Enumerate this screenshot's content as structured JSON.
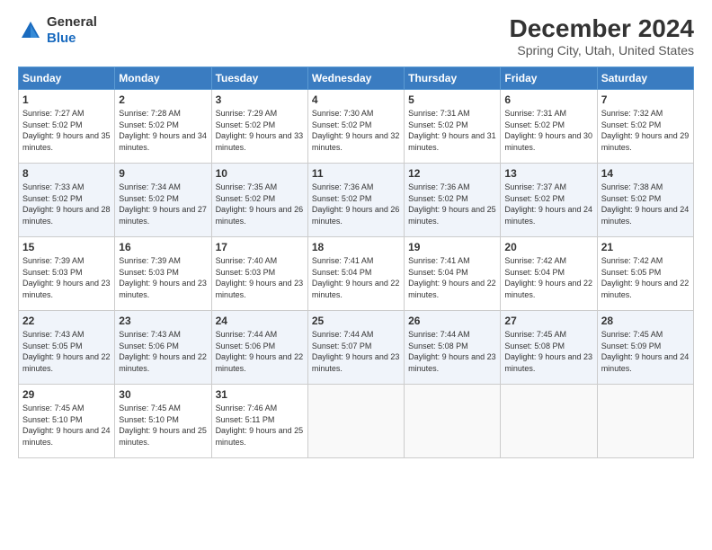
{
  "header": {
    "logo_line1": "General",
    "logo_line2": "Blue",
    "title": "December 2024",
    "subtitle": "Spring City, Utah, United States"
  },
  "weekdays": [
    "Sunday",
    "Monday",
    "Tuesday",
    "Wednesday",
    "Thursday",
    "Friday",
    "Saturday"
  ],
  "weeks": [
    [
      {
        "day": "1",
        "sunrise": "Sunrise: 7:27 AM",
        "sunset": "Sunset: 5:02 PM",
        "daylight": "Daylight: 9 hours and 35 minutes."
      },
      {
        "day": "2",
        "sunrise": "Sunrise: 7:28 AM",
        "sunset": "Sunset: 5:02 PM",
        "daylight": "Daylight: 9 hours and 34 minutes."
      },
      {
        "day": "3",
        "sunrise": "Sunrise: 7:29 AM",
        "sunset": "Sunset: 5:02 PM",
        "daylight": "Daylight: 9 hours and 33 minutes."
      },
      {
        "day": "4",
        "sunrise": "Sunrise: 7:30 AM",
        "sunset": "Sunset: 5:02 PM",
        "daylight": "Daylight: 9 hours and 32 minutes."
      },
      {
        "day": "5",
        "sunrise": "Sunrise: 7:31 AM",
        "sunset": "Sunset: 5:02 PM",
        "daylight": "Daylight: 9 hours and 31 minutes."
      },
      {
        "day": "6",
        "sunrise": "Sunrise: 7:31 AM",
        "sunset": "Sunset: 5:02 PM",
        "daylight": "Daylight: 9 hours and 30 minutes."
      },
      {
        "day": "7",
        "sunrise": "Sunrise: 7:32 AM",
        "sunset": "Sunset: 5:02 PM",
        "daylight": "Daylight: 9 hours and 29 minutes."
      }
    ],
    [
      {
        "day": "8",
        "sunrise": "Sunrise: 7:33 AM",
        "sunset": "Sunset: 5:02 PM",
        "daylight": "Daylight: 9 hours and 28 minutes."
      },
      {
        "day": "9",
        "sunrise": "Sunrise: 7:34 AM",
        "sunset": "Sunset: 5:02 PM",
        "daylight": "Daylight: 9 hours and 27 minutes."
      },
      {
        "day": "10",
        "sunrise": "Sunrise: 7:35 AM",
        "sunset": "Sunset: 5:02 PM",
        "daylight": "Daylight: 9 hours and 26 minutes."
      },
      {
        "day": "11",
        "sunrise": "Sunrise: 7:36 AM",
        "sunset": "Sunset: 5:02 PM",
        "daylight": "Daylight: 9 hours and 26 minutes."
      },
      {
        "day": "12",
        "sunrise": "Sunrise: 7:36 AM",
        "sunset": "Sunset: 5:02 PM",
        "daylight": "Daylight: 9 hours and 25 minutes."
      },
      {
        "day": "13",
        "sunrise": "Sunrise: 7:37 AM",
        "sunset": "Sunset: 5:02 PM",
        "daylight": "Daylight: 9 hours and 24 minutes."
      },
      {
        "day": "14",
        "sunrise": "Sunrise: 7:38 AM",
        "sunset": "Sunset: 5:02 PM",
        "daylight": "Daylight: 9 hours and 24 minutes."
      }
    ],
    [
      {
        "day": "15",
        "sunrise": "Sunrise: 7:39 AM",
        "sunset": "Sunset: 5:03 PM",
        "daylight": "Daylight: 9 hours and 23 minutes."
      },
      {
        "day": "16",
        "sunrise": "Sunrise: 7:39 AM",
        "sunset": "Sunset: 5:03 PM",
        "daylight": "Daylight: 9 hours and 23 minutes."
      },
      {
        "day": "17",
        "sunrise": "Sunrise: 7:40 AM",
        "sunset": "Sunset: 5:03 PM",
        "daylight": "Daylight: 9 hours and 23 minutes."
      },
      {
        "day": "18",
        "sunrise": "Sunrise: 7:41 AM",
        "sunset": "Sunset: 5:04 PM",
        "daylight": "Daylight: 9 hours and 22 minutes."
      },
      {
        "day": "19",
        "sunrise": "Sunrise: 7:41 AM",
        "sunset": "Sunset: 5:04 PM",
        "daylight": "Daylight: 9 hours and 22 minutes."
      },
      {
        "day": "20",
        "sunrise": "Sunrise: 7:42 AM",
        "sunset": "Sunset: 5:04 PM",
        "daylight": "Daylight: 9 hours and 22 minutes."
      },
      {
        "day": "21",
        "sunrise": "Sunrise: 7:42 AM",
        "sunset": "Sunset: 5:05 PM",
        "daylight": "Daylight: 9 hours and 22 minutes."
      }
    ],
    [
      {
        "day": "22",
        "sunrise": "Sunrise: 7:43 AM",
        "sunset": "Sunset: 5:05 PM",
        "daylight": "Daylight: 9 hours and 22 minutes."
      },
      {
        "day": "23",
        "sunrise": "Sunrise: 7:43 AM",
        "sunset": "Sunset: 5:06 PM",
        "daylight": "Daylight: 9 hours and 22 minutes."
      },
      {
        "day": "24",
        "sunrise": "Sunrise: 7:44 AM",
        "sunset": "Sunset: 5:06 PM",
        "daylight": "Daylight: 9 hours and 22 minutes."
      },
      {
        "day": "25",
        "sunrise": "Sunrise: 7:44 AM",
        "sunset": "Sunset: 5:07 PM",
        "daylight": "Daylight: 9 hours and 23 minutes."
      },
      {
        "day": "26",
        "sunrise": "Sunrise: 7:44 AM",
        "sunset": "Sunset: 5:08 PM",
        "daylight": "Daylight: 9 hours and 23 minutes."
      },
      {
        "day": "27",
        "sunrise": "Sunrise: 7:45 AM",
        "sunset": "Sunset: 5:08 PM",
        "daylight": "Daylight: 9 hours and 23 minutes."
      },
      {
        "day": "28",
        "sunrise": "Sunrise: 7:45 AM",
        "sunset": "Sunset: 5:09 PM",
        "daylight": "Daylight: 9 hours and 24 minutes."
      }
    ],
    [
      {
        "day": "29",
        "sunrise": "Sunrise: 7:45 AM",
        "sunset": "Sunset: 5:10 PM",
        "daylight": "Daylight: 9 hours and 24 minutes."
      },
      {
        "day": "30",
        "sunrise": "Sunrise: 7:45 AM",
        "sunset": "Sunset: 5:10 PM",
        "daylight": "Daylight: 9 hours and 25 minutes."
      },
      {
        "day": "31",
        "sunrise": "Sunrise: 7:46 AM",
        "sunset": "Sunset: 5:11 PM",
        "daylight": "Daylight: 9 hours and 25 minutes."
      },
      null,
      null,
      null,
      null
    ]
  ]
}
